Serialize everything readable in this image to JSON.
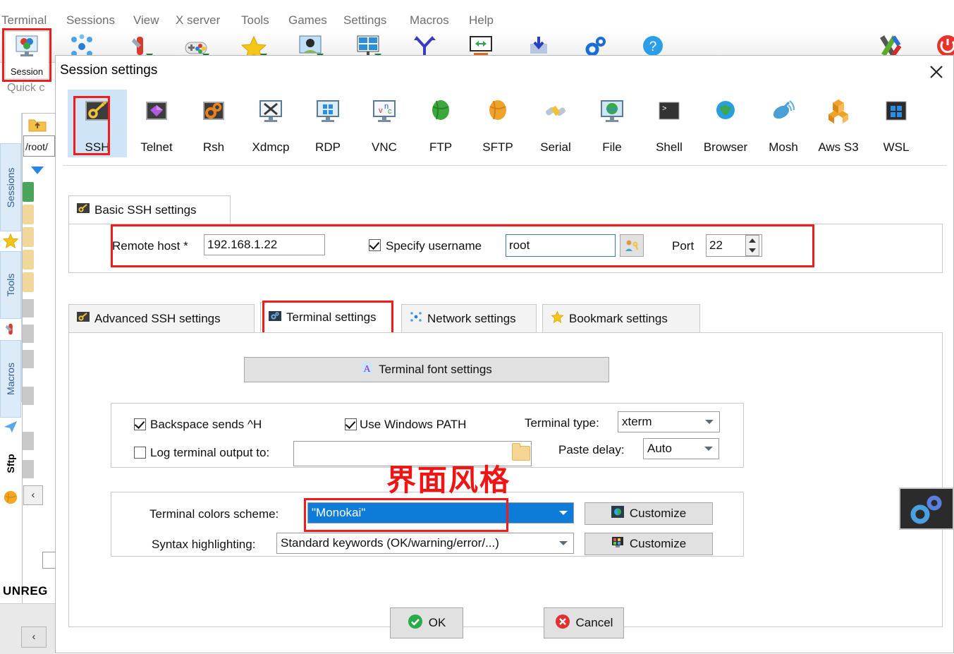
{
  "app": {
    "menu": [
      "Terminal",
      "Sessions",
      "View",
      "X server",
      "Tools",
      "Games",
      "Settings",
      "Macros",
      "Help"
    ],
    "session_button": "Session",
    "quick_connect": "Quick c",
    "path_box": "/root/",
    "unregistered": "UNREG",
    "side_tabs": [
      {
        "label": "Sessions",
        "icon": "star-icon"
      },
      {
        "label": "Tools",
        "icon": "swiss-knife-icon"
      },
      {
        "label": "Macros",
        "icon": "paper-plane-icon"
      },
      {
        "label": "Sftp",
        "icon": "globe-icon"
      }
    ],
    "toolbar_icons": [
      "session-icon",
      "servers-icon",
      "tools-icon",
      "games-icon",
      "favorites-icon",
      "user-sessions-icon",
      "split-view-icon",
      "tunneling-icon",
      "packages-icon",
      "download-icon",
      "settings-icon",
      "help-icon",
      "xserver-icon",
      "exit-icon"
    ]
  },
  "dialog": {
    "title": "Session settings",
    "close_icon": "close-icon",
    "protocols": [
      {
        "label": "SSH",
        "icon": "key-icon",
        "selected": true
      },
      {
        "label": "Telnet",
        "icon": "gem-icon",
        "selected": false
      },
      {
        "label": "Rsh",
        "icon": "gears-orange-icon",
        "selected": false
      },
      {
        "label": "Xdmcp",
        "icon": "x-monitor-icon",
        "selected": false
      },
      {
        "label": "RDP",
        "icon": "windows-monitor-icon",
        "selected": false
      },
      {
        "label": "VNC",
        "icon": "vnc-monitor-icon",
        "selected": false
      },
      {
        "label": "FTP",
        "icon": "green-globe-icon",
        "selected": false
      },
      {
        "label": "SFTP",
        "icon": "orange-globe-icon",
        "selected": false
      },
      {
        "label": "Serial",
        "icon": "plug-icon",
        "selected": false
      },
      {
        "label": "File",
        "icon": "globe-monitor-icon",
        "selected": false
      },
      {
        "label": "Shell",
        "icon": "console-icon",
        "selected": false
      },
      {
        "label": "Browser",
        "icon": "earth-icon",
        "selected": false
      },
      {
        "label": "Mosh",
        "icon": "satellite-dish-icon",
        "selected": false
      },
      {
        "label": "Aws S3",
        "icon": "aws-cubes-icon",
        "selected": false
      },
      {
        "label": "WSL",
        "icon": "windows-icon",
        "selected": false
      }
    ],
    "basic_group": {
      "tab_label": "Basic SSH settings",
      "tab_icon": "key-icon",
      "remote_host_label": "Remote host *",
      "remote_host_value": "192.168.1.22",
      "specify_username_label": "Specify username",
      "specify_username_checked": true,
      "username_value": "root",
      "user_browse_icon": "user-key-icon",
      "port_label": "Port",
      "port_value": "22"
    },
    "settings_tabs": [
      {
        "label": "Advanced SSH settings",
        "icon": "key-icon",
        "active": false
      },
      {
        "label": "Terminal settings",
        "icon": "terminal-gear-icon",
        "active": true
      },
      {
        "label": "Network settings",
        "icon": "network-nodes-icon",
        "active": false
      },
      {
        "label": "Bookmark settings",
        "icon": "star-icon",
        "active": false
      }
    ],
    "terminal_panel": {
      "font_settings_button": "Terminal font settings",
      "font_settings_icon": "font-a-icon",
      "backspace_label": "Backspace sends ^H",
      "backspace_checked": true,
      "windows_path_label": "Use Windows PATH",
      "windows_path_checked": true,
      "log_output_label": "Log terminal output to:",
      "log_output_checked": false,
      "log_output_value": "",
      "folder_icon": "folder-icon",
      "terminal_type_label": "Terminal type:",
      "terminal_type_value": "xterm",
      "paste_delay_label": "Paste delay:",
      "paste_delay_value": "Auto",
      "colors_scheme_label": "Terminal colors scheme:",
      "colors_scheme_value": "\"Monokai\"",
      "colors_customize_label": "Customize",
      "colors_customize_icon": "color-wheel-icon",
      "syntax_label": "Syntax highlighting:",
      "syntax_value": "Standard keywords (OK/warning/error/...)",
      "syntax_customize_label": "Customize",
      "syntax_customize_icon": "syntax-colors-icon",
      "preview_icon": "gears-dark-icon"
    },
    "ok_label": "OK",
    "ok_icon": "check-circle-icon",
    "cancel_label": "Cancel",
    "cancel_icon": "x-circle-icon"
  },
  "annotation": {
    "chinese_note": "界面风格",
    "highlight_color": "#f41b1b"
  }
}
